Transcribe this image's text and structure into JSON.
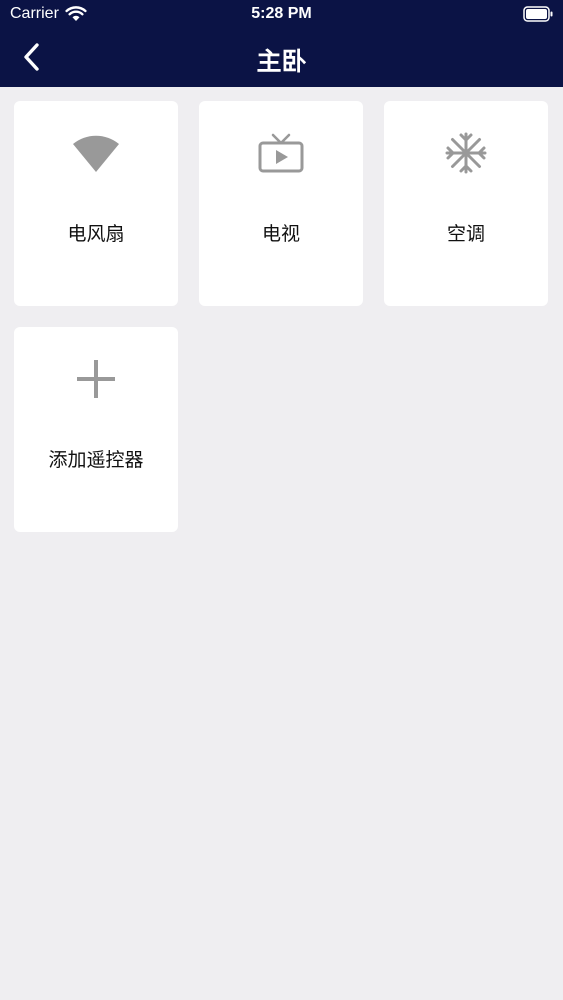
{
  "status_bar": {
    "carrier": "Carrier",
    "time": "5:28 PM",
    "wifi_icon": "wifi-icon",
    "battery_icon": "battery-icon"
  },
  "nav": {
    "title": "主卧",
    "back_icon": "chevron-left-icon"
  },
  "devices": [
    {
      "label": "电风扇",
      "icon": "fan-icon"
    },
    {
      "label": "电视",
      "icon": "tv-icon"
    },
    {
      "label": "空调",
      "icon": "snowflake-icon"
    },
    {
      "label": "添加遥控器",
      "icon": "plus-icon"
    }
  ],
  "colors": {
    "header_bg": "#0b1345",
    "page_bg": "#efeef1",
    "card_bg": "#ffffff",
    "icon_gray": "#999999"
  }
}
